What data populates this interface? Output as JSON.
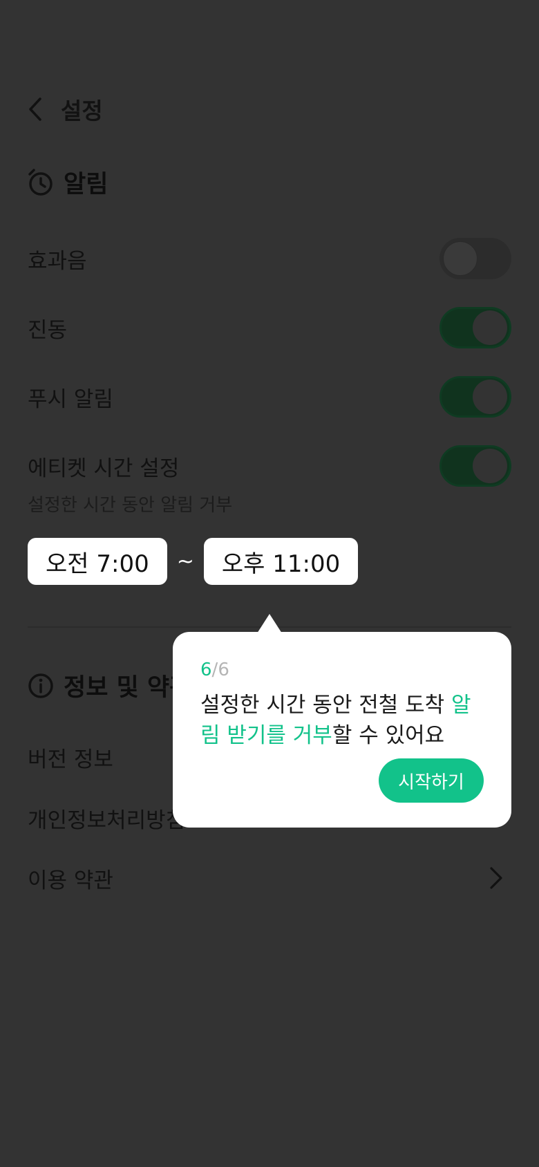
{
  "header": {
    "title": "설정"
  },
  "alarm_section": {
    "title": "알림",
    "rows": [
      {
        "label": "효과음",
        "on": false
      },
      {
        "label": "진동",
        "on": true
      },
      {
        "label": "푸시 알림",
        "on": true
      },
      {
        "label": "에티켓 시간 설정",
        "on": true
      }
    ],
    "etiquette_desc": "설정한 시간 동안 알림 거부",
    "time_start": "오전 7:00",
    "time_sep": "~",
    "time_end": "오후 11:00"
  },
  "info_section": {
    "title": "정보 및 약관",
    "items": [
      {
        "label": "버전 정보"
      },
      {
        "label": "개인정보처리방침"
      },
      {
        "label": "이용 약관"
      }
    ]
  },
  "tooltip": {
    "step_current": "6",
    "step_sep": "/",
    "step_total": "6",
    "text_part1": "설정한 시간 동안 전철 도착 ",
    "text_highlight": "알림 받기를 거부",
    "text_part2": "할 수 있어요",
    "button_label": "시작하기"
  },
  "colors": {
    "accent": "#12c28a",
    "background_dimmed": "#333333"
  },
  "icons": {
    "back": "chevron-left-icon",
    "alarm": "alarm-clock-icon",
    "info": "info-circle-icon",
    "chevron": "chevron-right-icon"
  }
}
